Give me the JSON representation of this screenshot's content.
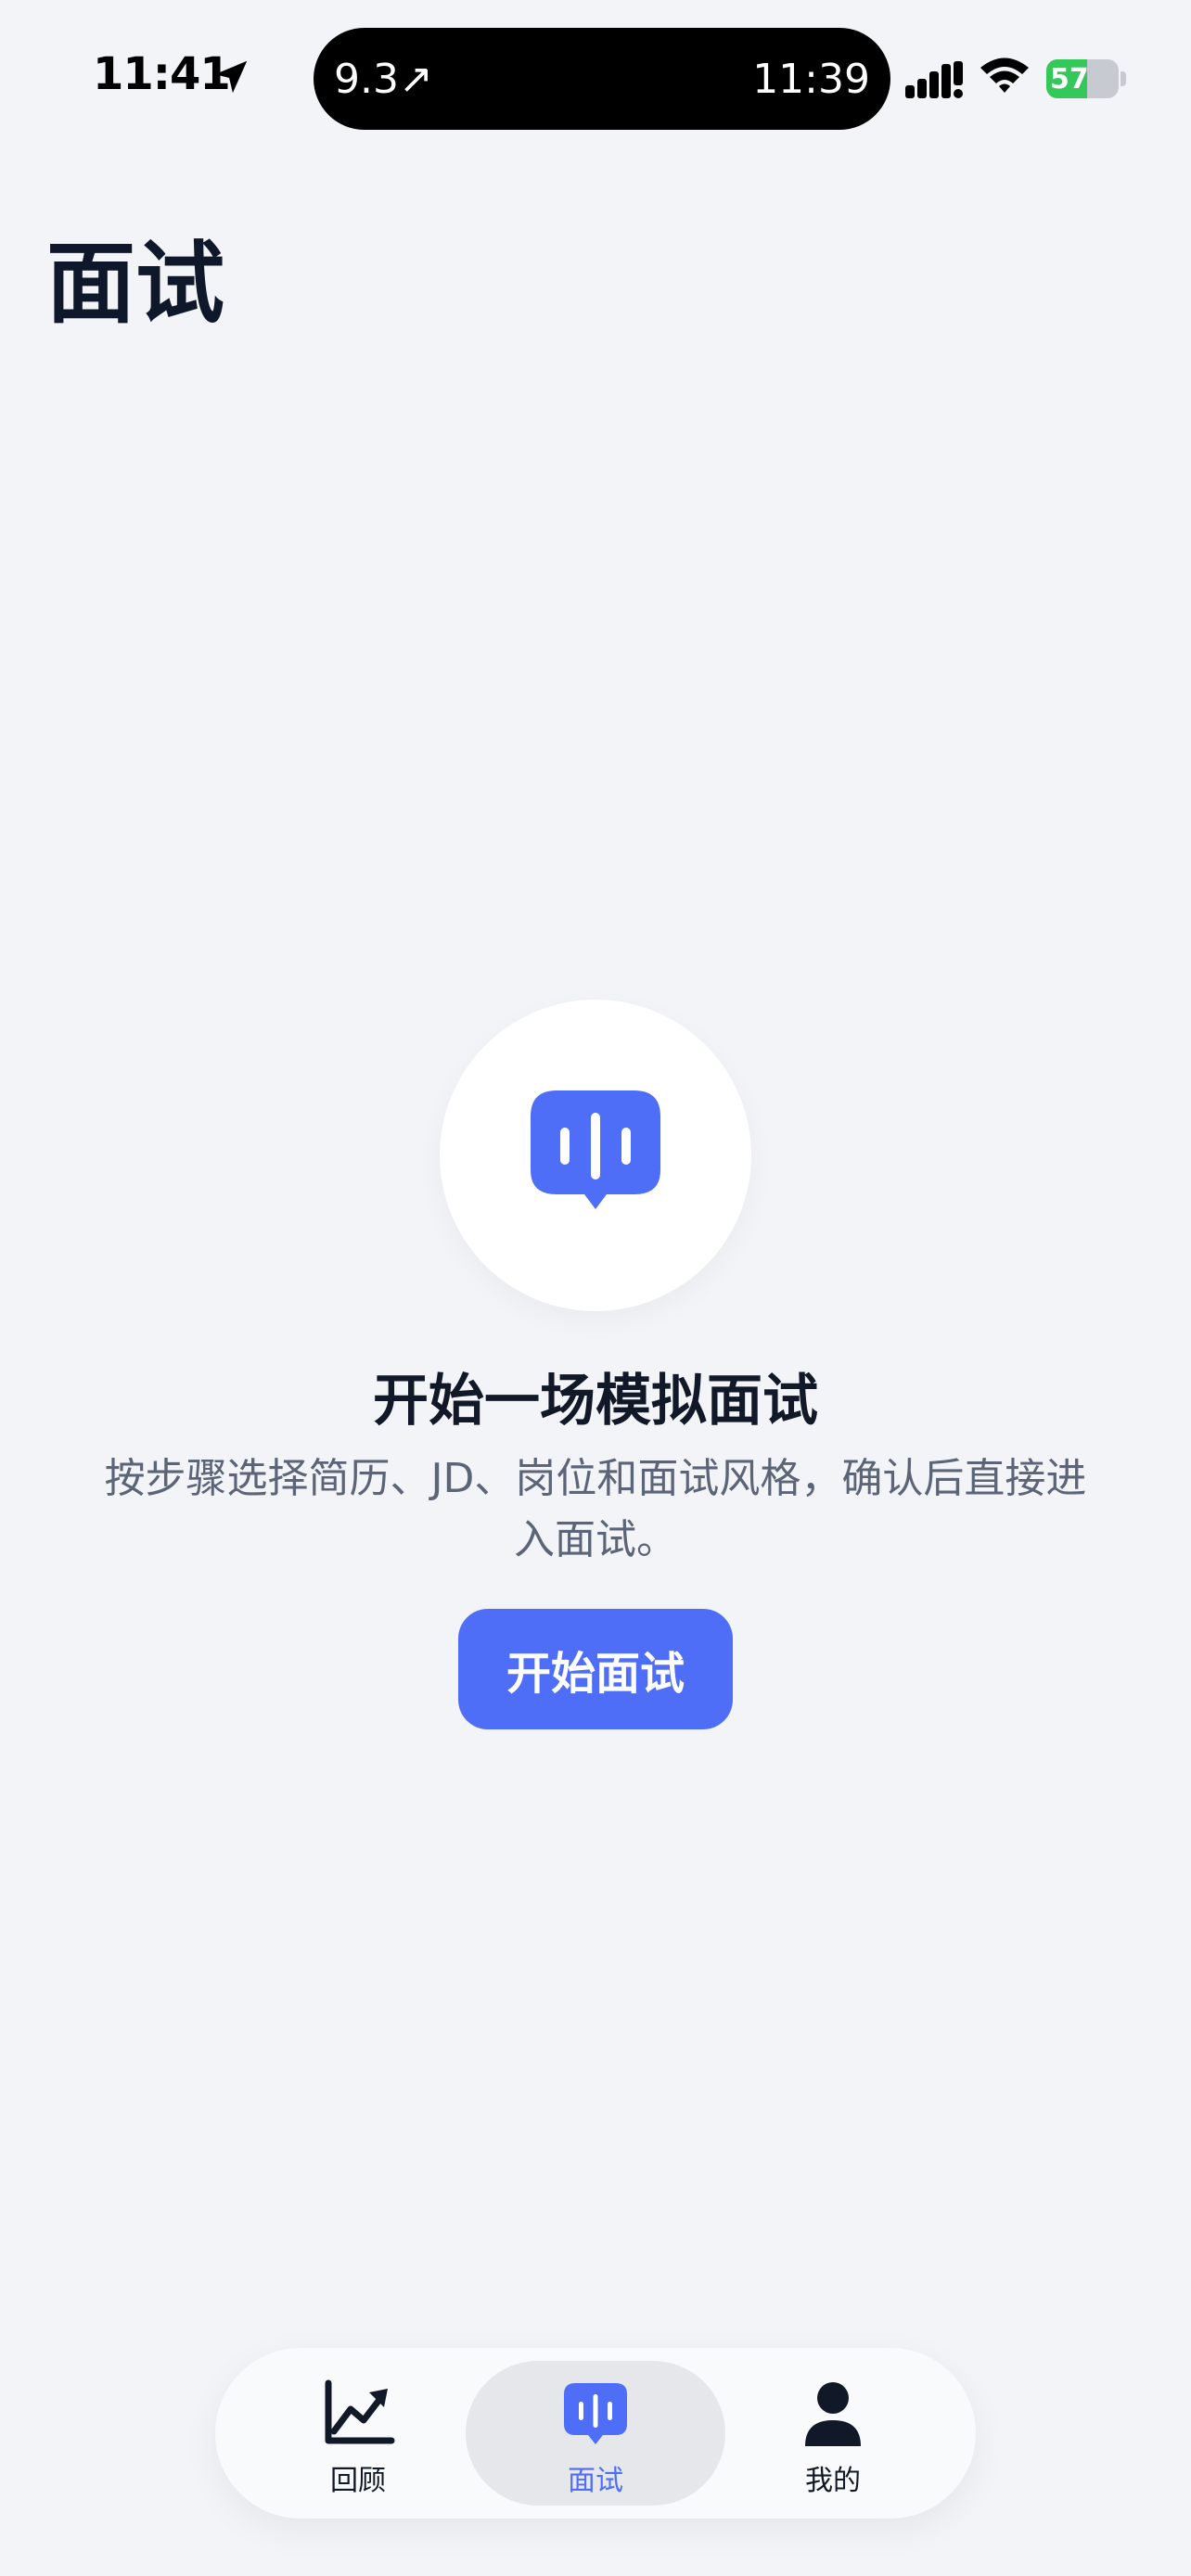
{
  "status_bar": {
    "time": "11:41",
    "island_left": "9.3↗",
    "island_right": "11:39",
    "battery": "57",
    "battery_level": 0.57
  },
  "page": {
    "title": "面试"
  },
  "hero": {
    "icon": "voice-message-icon",
    "heading": "开始一场模拟面试",
    "description": "按步骤选择简历、JD、岗位和面试风格，确认后直接进入面试。",
    "button_label": "开始面试"
  },
  "tabs": [
    {
      "label": "回顾",
      "icon": "chart-trend-icon",
      "active": false
    },
    {
      "label": "面试",
      "icon": "voice-message-icon",
      "active": true
    },
    {
      "label": "我的",
      "icon": "person-icon",
      "active": false
    }
  ],
  "colors": {
    "accent": "#4F6EF7",
    "background": "#F3F4F7",
    "battery_green": "#34C759"
  }
}
